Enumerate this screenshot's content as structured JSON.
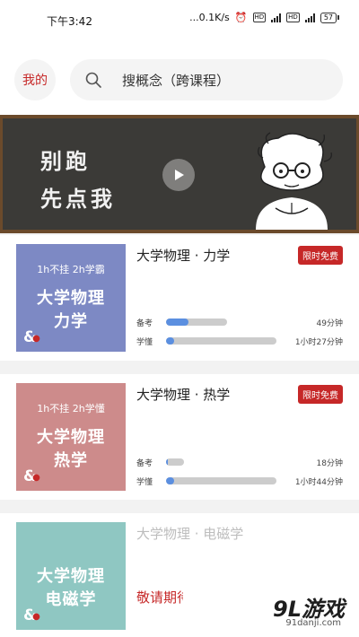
{
  "status_bar": {
    "time": "下午3:42",
    "network_speed": "...0.1K/s",
    "hd1": "HD",
    "sig1": "4G",
    "hd2": "HD",
    "sig2": "4G",
    "battery": "57"
  },
  "header": {
    "mine_label": "我的",
    "search_placeholder": "搜概念（跨课程）"
  },
  "banner": {
    "line1": "别跑",
    "line2": "先点我"
  },
  "courses": [
    {
      "cover_tag": "1h不挂 2h学霸",
      "cover_title_1": "大学物理",
      "cover_title_2": "力学",
      "cover_color": "#7d89c4",
      "title": "大学物理 · 力学",
      "badge": "限时免费",
      "prep_label": "备考",
      "prep_progress": 0.37,
      "prep_duration": "49分钟",
      "learn_label": "学懂",
      "learn_progress": 0.07,
      "learn_duration": "1小时27分钟"
    },
    {
      "cover_tag": "1h不挂 2h学懂",
      "cover_title_1": "大学物理",
      "cover_title_2": "热学",
      "cover_color": "#cd8b8b",
      "title": "大学物理 · 热学",
      "badge": "限时免费",
      "prep_label": "备考",
      "prep_progress": 0.12,
      "prep_duration": "18分钟",
      "learn_label": "学懂",
      "learn_progress": 0.07,
      "learn_duration": "1小时44分钟"
    },
    {
      "cover_title_1": "大学物理",
      "cover_title_2": "电磁学",
      "cover_color": "#8fc7c2",
      "title": "大学物理 · 电磁学",
      "coming_soon": "敬请期待"
    }
  ],
  "watermark": {
    "brand": "9L游戏",
    "url": "91danji.com"
  }
}
